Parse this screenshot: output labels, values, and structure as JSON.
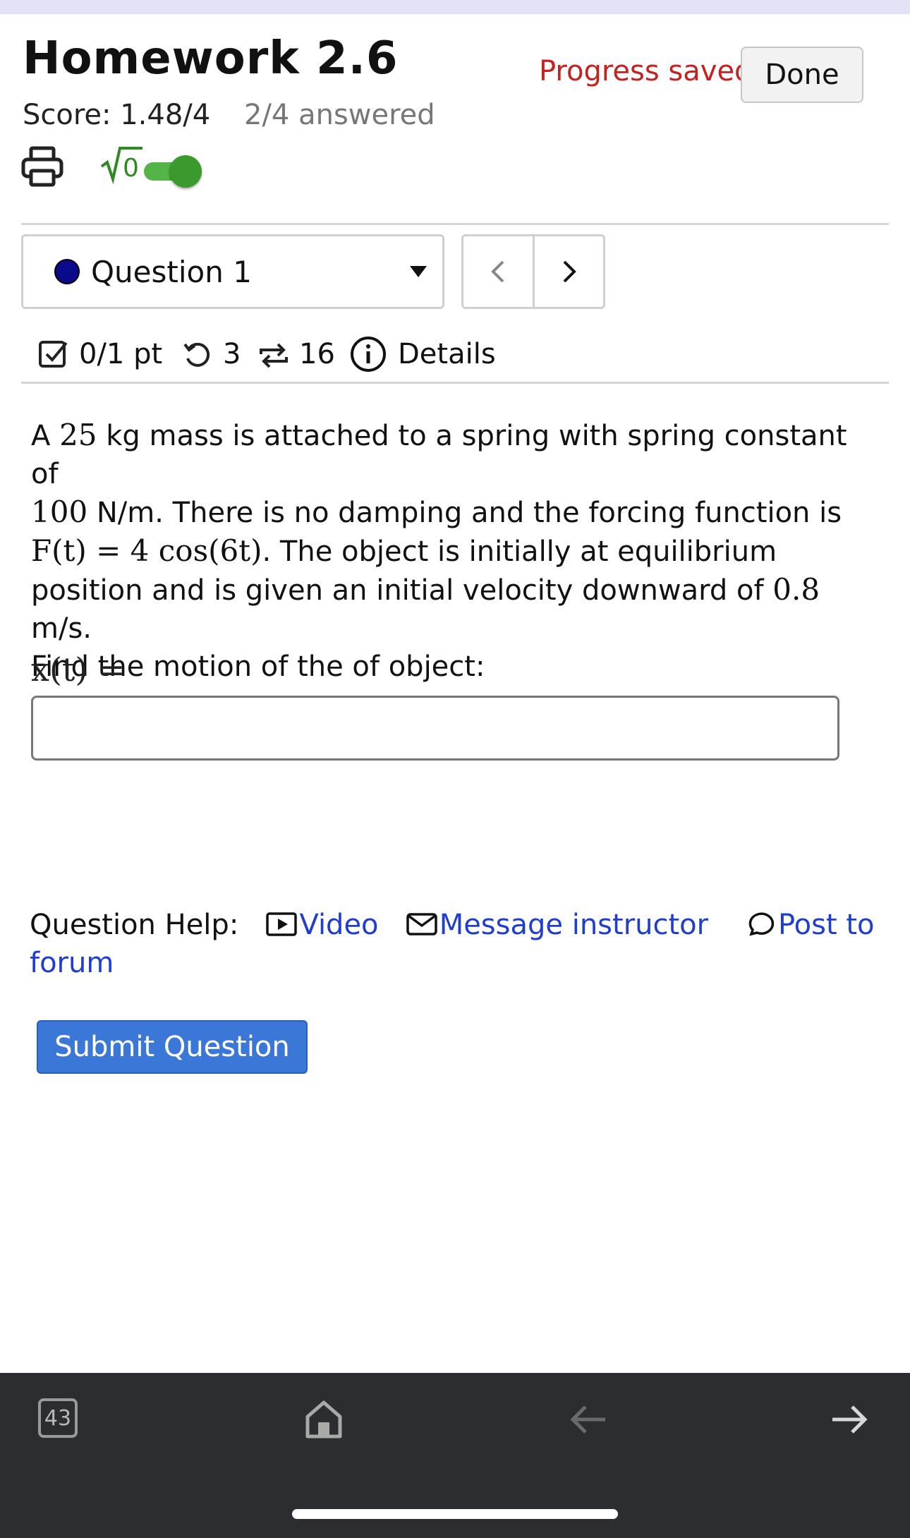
{
  "header": {
    "title": "Homework 2.6",
    "progress_status": "Progress saved",
    "done_label": "Done",
    "score": "Score: 1.48/4",
    "answered": "2/4 answered",
    "math_toggle_icon_label": "√0",
    "math_toggle_on": true
  },
  "question_nav": {
    "selected": "Question 1",
    "status_dot_color": "#0a0a8c",
    "prev_icon": "chevron-left",
    "next_icon": "chevron-right"
  },
  "meta": {
    "points": "0/1 pt",
    "retries": "3",
    "attempts": "16",
    "details_label": "Details"
  },
  "question": {
    "line1_a": "A ",
    "mass": "25",
    "line1_b": " kg mass is attached to a spring with spring constant of",
    "spring": "100",
    "line2_b": " N/m. There is no damping and the forcing function is",
    "forcing": "F(t) = 4 cos(6t)",
    "line3_b": ". The object is initially at equilibrium",
    "line4_a": "position and is given an initial velocity downward of ",
    "velocity": "0.8",
    "line4_b": " m/s.",
    "line5": "Find the motion of the of object:",
    "answer_label": "x(t) =",
    "answer_value": ""
  },
  "help": {
    "label": "Question Help:",
    "video": "Video",
    "message": "Message instructor",
    "forum_a": "Post to",
    "forum_b": "forum"
  },
  "submit_label": "Submit Question",
  "browser_bar": {
    "tab_count": "43",
    "home_icon": "home-icon",
    "back_icon": "back-arrow-icon",
    "forward_icon": "forward-arrow-icon"
  },
  "colors": {
    "accent_link": "#1f3ecf",
    "submit_bg": "#3b77d6",
    "saved_red": "#c4211f",
    "toggle_green": "#55b447"
  }
}
